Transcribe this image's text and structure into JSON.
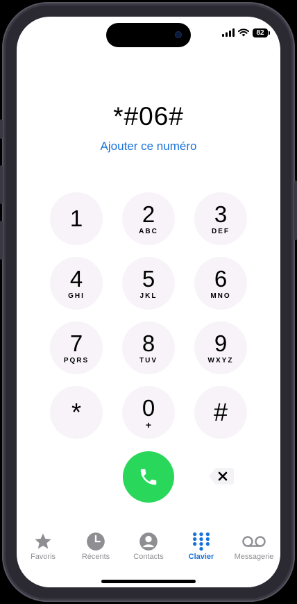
{
  "status_bar": {
    "battery": "82"
  },
  "dialer": {
    "number": "*#06#",
    "add_number_label": "Ajouter ce numéro"
  },
  "keypad": [
    {
      "digit": "1",
      "letters": ""
    },
    {
      "digit": "2",
      "letters": "ABC"
    },
    {
      "digit": "3",
      "letters": "DEF"
    },
    {
      "digit": "4",
      "letters": "GHI"
    },
    {
      "digit": "5",
      "letters": "JKL"
    },
    {
      "digit": "6",
      "letters": "MNO"
    },
    {
      "digit": "7",
      "letters": "PQRS"
    },
    {
      "digit": "8",
      "letters": "TUV"
    },
    {
      "digit": "9",
      "letters": "WXYZ"
    },
    {
      "digit": "*",
      "letters": ""
    },
    {
      "digit": "0",
      "letters": "+"
    },
    {
      "digit": "#",
      "letters": ""
    }
  ],
  "tabbar": {
    "items": [
      {
        "label": "Favoris",
        "icon": "star-icon",
        "active": false
      },
      {
        "label": "Récents",
        "icon": "clock-icon",
        "active": false
      },
      {
        "label": "Contacts",
        "icon": "person-icon",
        "active": false
      },
      {
        "label": "Clavier",
        "icon": "keypad-icon",
        "active": true
      },
      {
        "label": "Messagerie",
        "icon": "voicemail-icon",
        "active": false
      }
    ]
  },
  "colors": {
    "accent": "#1a73d9",
    "call": "#29d75b",
    "key_background": "#f7f3f8",
    "tab_inactive": "#8e8e93"
  }
}
